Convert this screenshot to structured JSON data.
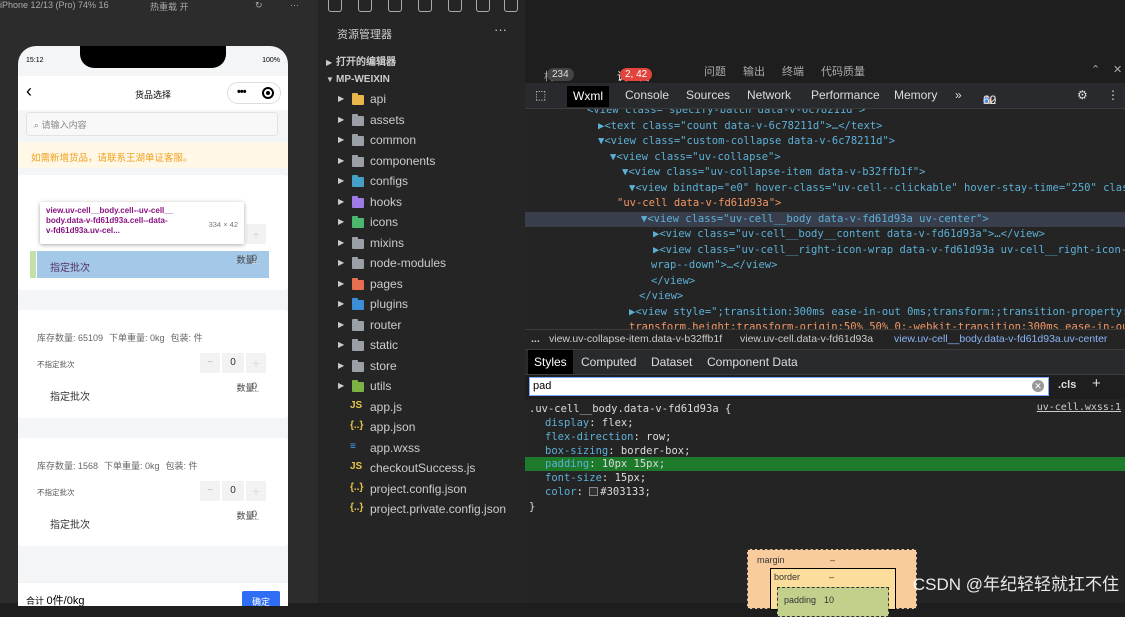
{
  "simulator": {
    "device_label": "iPhone 12/13 (Pro) 74% 16",
    "hotreload": "热重载 开"
  },
  "phone": {
    "time": "15:12",
    "battery": "100%",
    "nav_title": "货品选择",
    "search_placeholder": "请输入内容",
    "notice": "如需新增货品，请联系王湖单证客服。",
    "tooltip": {
      "line1": "view.uv-cell__body.cell--uv-cell__",
      "line2": "body.data-v-fd61d93a.cell--data-",
      "line3": "v-fd61d93a.uv-cel...",
      "size": "334 × 42"
    },
    "cards": [
      {
        "stock": "",
        "no_batch": "",
        "qty": "0",
        "qty_label": "数量:",
        "qty_value": "0",
        "batch": "指定批次"
      },
      {
        "stock": "库存数量: 65109",
        "weight": "下单重量: 0kg",
        "pack": "包装: 件",
        "no_batch": "不指定批次",
        "qty": "0",
        "qty_label": "数量:",
        "qty_value": "0",
        "batch": "指定批次"
      },
      {
        "stock": "库存数量: 1568",
        "weight": "下单重量: 0kg",
        "pack": "包装: 件",
        "no_batch": "不指定批次",
        "qty": "0",
        "qty_label": "数量:",
        "qty_value": "0",
        "batch": "指定批次"
      }
    ],
    "total_label": "合计",
    "total_value": "0件/0kg",
    "confirm": "确定"
  },
  "explorer": {
    "title": "资源管理器",
    "open_editors": "打开的编辑器",
    "project": "MP-WEIXIN",
    "items": [
      {
        "name": "api",
        "type": "folder",
        "color": "#e8b64a"
      },
      {
        "name": "assets",
        "type": "folder",
        "color": "#9aa0a6"
      },
      {
        "name": "common",
        "type": "folder",
        "color": "#9aa0a6"
      },
      {
        "name": "components",
        "type": "folder",
        "color": "#9aa0a6"
      },
      {
        "name": "configs",
        "type": "folder",
        "color": "#45a0c9"
      },
      {
        "name": "hooks",
        "type": "folder",
        "color": "#a07be8"
      },
      {
        "name": "icons",
        "type": "folder",
        "color": "#4cb86f"
      },
      {
        "name": "mixins",
        "type": "folder",
        "color": "#9aa0a6"
      },
      {
        "name": "node-modules",
        "type": "folder",
        "color": "#9aa0a6"
      },
      {
        "name": "pages",
        "type": "folder",
        "color": "#e76f51"
      },
      {
        "name": "plugins",
        "type": "folder",
        "color": "#3b8fd6"
      },
      {
        "name": "router",
        "type": "folder",
        "color": "#9aa0a6"
      },
      {
        "name": "static",
        "type": "folder",
        "color": "#9aa0a6"
      },
      {
        "name": "store",
        "type": "folder",
        "color": "#9aa0a6"
      },
      {
        "name": "utils",
        "type": "folder",
        "color": "#7cb342"
      },
      {
        "name": "app.js",
        "type": "file",
        "glyph": "JS",
        "color": "#e8c44a"
      },
      {
        "name": "app.json",
        "type": "file",
        "glyph": "{..}",
        "color": "#e8c44a"
      },
      {
        "name": "app.wxss",
        "type": "file",
        "glyph": "≡",
        "color": "#42a5f5"
      },
      {
        "name": "checkoutSuccess.js",
        "type": "file",
        "glyph": "JS",
        "color": "#e8c44a"
      },
      {
        "name": "project.config.json",
        "type": "file",
        "glyph": "{..}",
        "color": "#e8c44a"
      },
      {
        "name": "project.private.config.json",
        "type": "file",
        "glyph": "{..}",
        "color": "#e8c44a"
      }
    ]
  },
  "debug_tabs": {
    "build": "构建",
    "build_count": "234",
    "debugger": "调试器",
    "debugger_count": "2, 42",
    "problems": "问题",
    "output": "输出",
    "terminal": "终端",
    "quality": "代码质量"
  },
  "tools_tabs": {
    "wxml": "Wxml",
    "console": "Console",
    "sources": "Sources",
    "network": "Network",
    "performance": "Performance",
    "memory": "Memory",
    "more": "»",
    "errors": "2",
    "warnings": "42",
    "info": "60"
  },
  "dom_lines": [
    {
      "t": "<view class=\"specify-batch data-v-6c78211d\">"
    },
    {
      "t": "▶<text class=\"count data-v-6c78211d\">…</text>"
    },
    {
      "t": "▼<view class=\"custom-collapse data-v-6c78211d\">"
    },
    {
      "t": "▼<view class=\"uv-collapse\">"
    },
    {
      "t": "▼<view class=\"uv-collapse-item data-v-b32ffb1f\">"
    },
    {
      "t": "▼<view bindtap=\"e0\" hover-class=\"uv-cell--clickable\" hover-stay-time=\"250\" class="
    },
    {
      "t": "\"uv-cell data-v-fd61d93a\">"
    },
    {
      "t": "▼<view class=\"uv-cell__body data-v-fd61d93a uv-center\">"
    },
    {
      "t": "▶<view class=\"uv-cell__body__content data-v-fd61d93a\">…</view>"
    },
    {
      "t": "▶<view class=\"uv-cell__right-icon-wrap data-v-fd61d93a uv-cell__right-icon-"
    },
    {
      "t": "wrap--down\">…</view>"
    },
    {
      "t": "</view>"
    },
    {
      "t": "</view>"
    },
    {
      "t": "▶<view style=\";transition:300ms ease-in-out 0ms;transform:;transition-property:"
    },
    {
      "t": "transform,height;transform-origin:50% 50% 0;-webkit-transition:300ms ease-in-out"
    }
  ],
  "crumbs": {
    "c1": "...",
    "c2": "view.uv-collapse-item.data-v-b32ffb1f",
    "c3": "view.uv-cell.data-v-fd61d93a",
    "c4": "view.uv-cell__body.data-v-fd61d93a.uv-center"
  },
  "styles_tabs": {
    "styles": "Styles",
    "computed": "Computed",
    "dataset": "Dataset",
    "component_data": "Component Data"
  },
  "filter": {
    "value": "pad",
    "cls": ".cls",
    "plus": "+"
  },
  "rule": {
    "selector": ".uv-cell__body.data-v-fd61d93a {",
    "source": "uv-cell.wxss:1",
    "props": [
      {
        "p": "display",
        "v": "flex;"
      },
      {
        "p": "flex-direction",
        "v": "row;"
      },
      {
        "p": "box-sizing",
        "v": "border-box;"
      },
      {
        "p": "padding",
        "v": "10px 15px;"
      },
      {
        "p": "font-size",
        "v": "15px;"
      },
      {
        "p": "color",
        "v": "#303133;"
      }
    ],
    "close": "}"
  },
  "box": {
    "margin": "margin",
    "margin_dash": "–",
    "border": "border",
    "border_dash": "–",
    "padding": "padding",
    "padding_val": "10"
  },
  "watermark": "CSDN @年纪轻轻就扛不住"
}
